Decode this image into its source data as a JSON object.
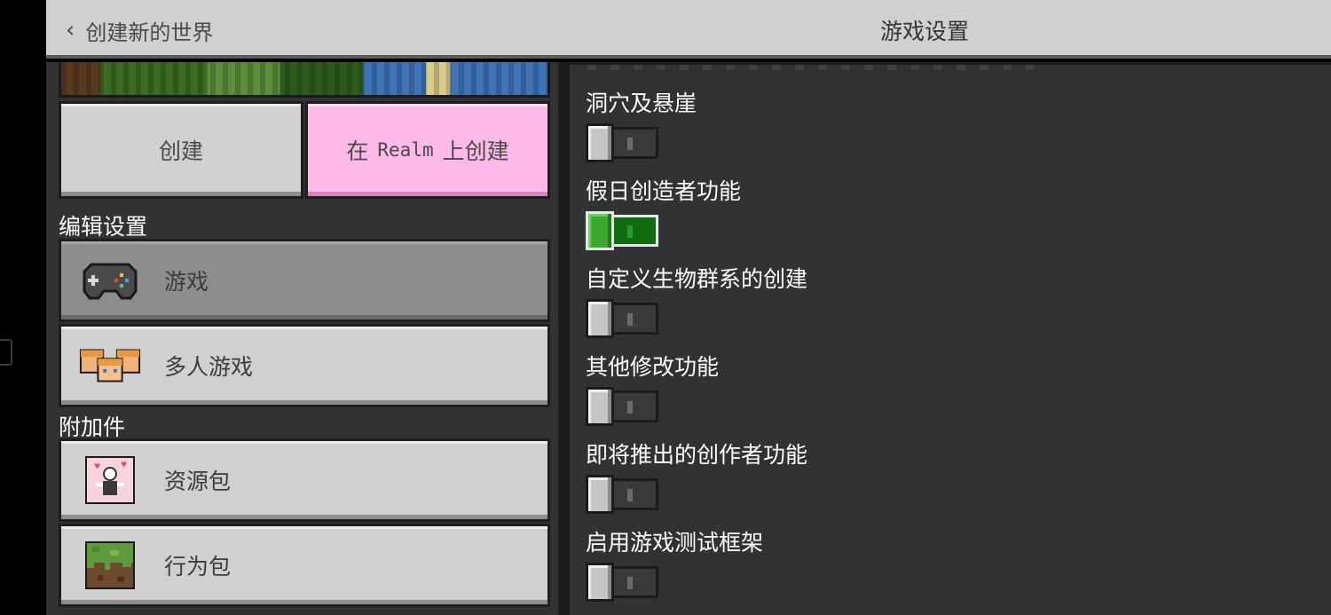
{
  "header": {
    "back_label": "创建新的世界",
    "title": "游戏设置"
  },
  "left": {
    "create_label": "创建",
    "realm_prefix": "在",
    "realm_name": "Realm",
    "realm_suffix": "上创建",
    "edit_settings_heading": "编辑设置",
    "addons_heading": "附加件",
    "nav": [
      {
        "label": "游戏",
        "icon": "gamepad-icon",
        "active": true
      },
      {
        "label": "多人游戏",
        "icon": "players-icon",
        "active": false
      },
      {
        "label": "资源包",
        "icon": "resource-pack-icon",
        "active": false
      },
      {
        "label": "行为包",
        "icon": "grass-block-icon",
        "active": false
      }
    ]
  },
  "settings": [
    {
      "label": "洞穴及悬崖",
      "on": false
    },
    {
      "label": "假日创造者功能",
      "on": true
    },
    {
      "label": "自定义生物群系的创建",
      "on": false
    },
    {
      "label": "其他修改功能",
      "on": false
    },
    {
      "label": "即将推出的创作者功能",
      "on": false
    },
    {
      "label": "启用游戏测试框架",
      "on": false
    }
  ],
  "colors": {
    "header_bg": "#d0d0d0",
    "panel_bg": "#313233",
    "realm_button": "#fdb9e7",
    "toggle_on": "#3aa82e",
    "nav_active": "#8d8d8d"
  }
}
